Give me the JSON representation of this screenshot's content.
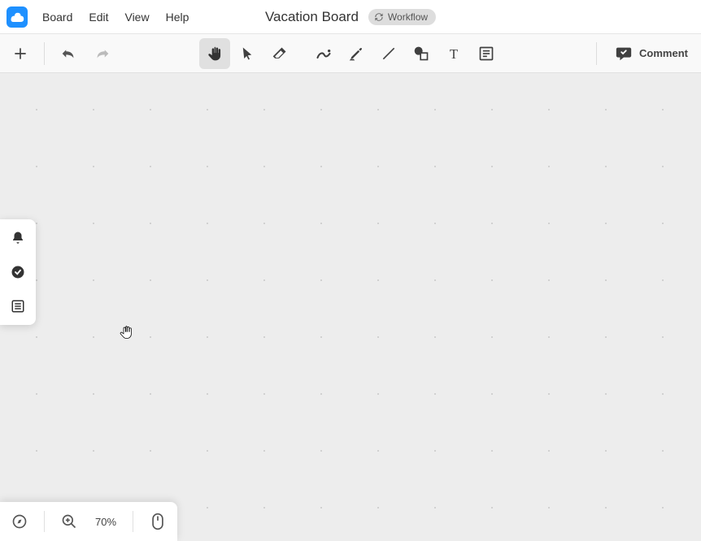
{
  "menu": {
    "items": [
      "Board",
      "Edit",
      "View",
      "Help"
    ]
  },
  "board": {
    "title": "Vacation Board",
    "workflow_label": "Workflow"
  },
  "toolbar": {
    "comment_label": "Comment"
  },
  "zoom": {
    "level": "70%"
  }
}
